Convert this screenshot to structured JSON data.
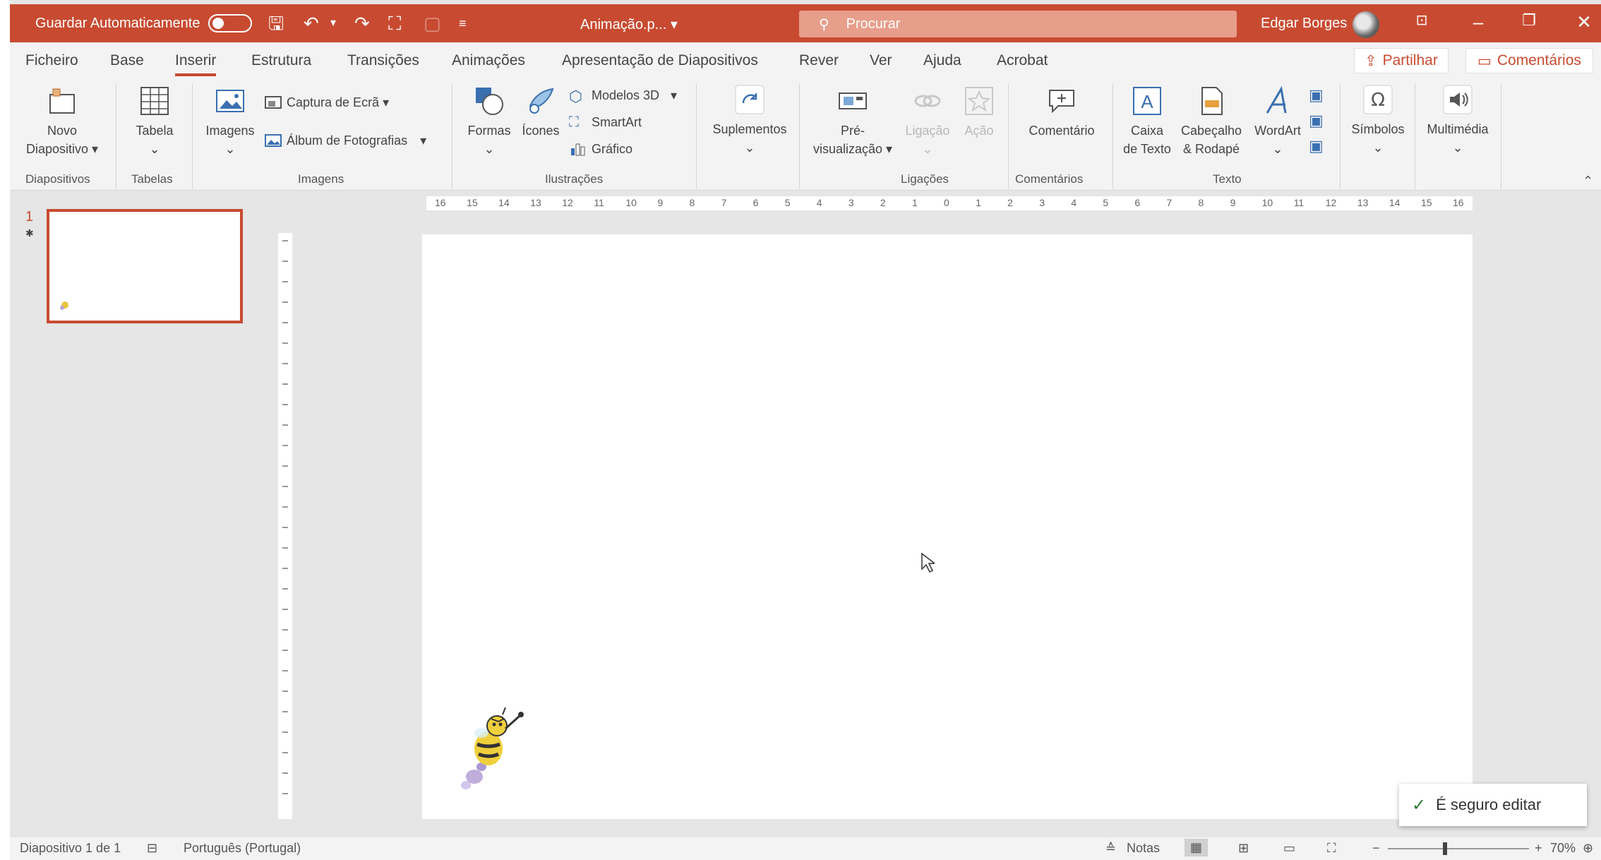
{
  "titlebar": {
    "autosave_label": "Guardar Automaticamente",
    "filename": "Animação.p... ▾",
    "search_placeholder": "Procurar",
    "user": "Edgar Borges",
    "accent_color": "#c84b31"
  },
  "tabs": [
    {
      "label": "Ficheiro"
    },
    {
      "label": "Base"
    },
    {
      "label": "Inserir"
    },
    {
      "label": "Estrutura"
    },
    {
      "label": "Transições"
    },
    {
      "label": "Animações"
    },
    {
      "label": "Apresentação de Diapositivos"
    },
    {
      "label": "Rever"
    },
    {
      "label": "Ver"
    },
    {
      "label": "Ajuda"
    },
    {
      "label": "Acrobat"
    }
  ],
  "share_label": "Partilhar",
  "comments_label": "Comentários",
  "ribbon": {
    "new_slide": "Novo",
    "new_slide2": "Diapositivo ▾",
    "table": "Tabela",
    "images": "Imagens",
    "screenshot": "Captura de Ecrã ▾",
    "photo_album": "Álbum de Fotografias",
    "shapes": "Formas",
    "icons": "Ícones",
    "models3d": "Modelos 3D",
    "smartart": "SmartArt",
    "chart": "Gráfico",
    "addins": "Suplementos",
    "preview1": "Pré-",
    "preview2": "visualização ▾",
    "link": "Ligação",
    "action": "Ação",
    "comment": "Comentário",
    "textbox1": "Caixa",
    "textbox2": "de Texto",
    "header1": "Cabeçalho",
    "header2": "& Rodapé",
    "wordart": "WordArt",
    "symbols": "Símbolos",
    "media": "Multimédia",
    "groups": {
      "slides": "Diapositivos",
      "tables": "Tabelas",
      "images": "Imagens",
      "illustrations": "Ilustrações",
      "links": "Ligações",
      "comments": "Comentários",
      "text": "Texto"
    }
  },
  "ruler_ticks": [
    "16",
    "15",
    "14",
    "13",
    "12",
    "11",
    "10",
    "9",
    "8",
    "7",
    "6",
    "5",
    "4",
    "3",
    "2",
    "1",
    "0",
    "1",
    "2",
    "3",
    "4",
    "5",
    "6",
    "7",
    "8",
    "9",
    "10",
    "11",
    "12",
    "13",
    "14",
    "15",
    "16"
  ],
  "thumbnail": {
    "number": "1",
    "marker": "✱"
  },
  "toast": {
    "text": "É seguro editar"
  },
  "statusbar": {
    "slide_info": "Diapositivo 1 de 1",
    "language": "Português (Portugal)",
    "notes": "Notas",
    "zoom": "70%"
  }
}
